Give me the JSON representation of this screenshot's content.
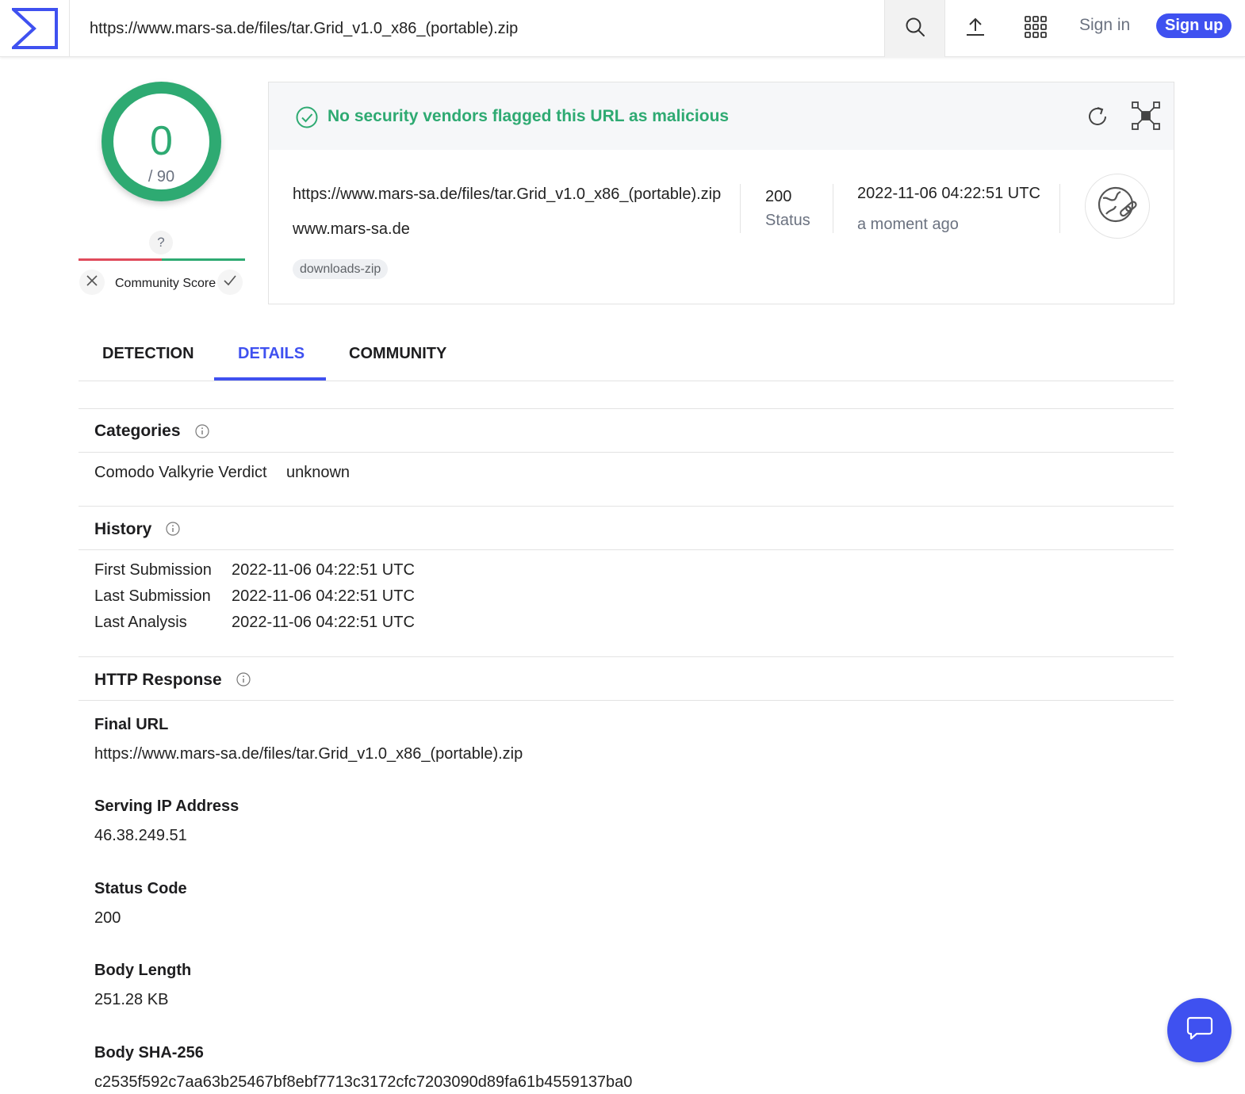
{
  "topbar": {
    "url_value": "https://www.mars-sa.de/files/tar.Grid_v1.0_x86_(portable).zip",
    "sign_in": "Sign in",
    "sign_up": "Sign up"
  },
  "score": {
    "detections": "0",
    "total": "/ 90",
    "community_question": "?",
    "community_label": "Community Score"
  },
  "summary": {
    "verdict": "No security vendors flagged this URL as malicious",
    "url": "https://www.mars-sa.de/files/tar.Grid_v1.0_x86_(portable).zip",
    "domain": "www.mars-sa.de",
    "tag": "downloads-zip",
    "status_code": "200",
    "status_label": "Status",
    "date": "2022-11-06 04:22:51 UTC",
    "date_relative": "a moment ago"
  },
  "tabs": [
    {
      "label": "DETECTION",
      "active": false
    },
    {
      "label": "DETAILS",
      "active": true
    },
    {
      "label": "COMMUNITY",
      "active": false
    }
  ],
  "categories": {
    "title": "Categories",
    "rows": [
      {
        "key": "Comodo Valkyrie Verdict",
        "value": "unknown"
      }
    ]
  },
  "history": {
    "title": "History",
    "rows": [
      {
        "key": "First Submission",
        "value": "2022-11-06 04:22:51 UTC"
      },
      {
        "key": "Last Submission",
        "value": "2022-11-06 04:22:51 UTC"
      },
      {
        "key": "Last Analysis",
        "value": "2022-11-06 04:22:51 UTC"
      }
    ]
  },
  "http_response": {
    "title": "HTTP Response",
    "fields": [
      {
        "label": "Final URL",
        "value": "https://www.mars-sa.de/files/tar.Grid_v1.0_x86_(portable).zip"
      },
      {
        "label": "Serving IP Address",
        "value": "46.38.249.51"
      },
      {
        "label": "Status Code",
        "value": "200"
      },
      {
        "label": "Body Length",
        "value": "251.28 KB"
      },
      {
        "label": "Body SHA-256",
        "value": "c2535f592c7aa63b25467bf8ebf7713c3172cfc7203090d89fa61b4559137ba0"
      }
    ]
  },
  "colors": {
    "accent": "#3f51f0",
    "clean_green": "#2eaa72",
    "malicious_red": "#e04b5b"
  },
  "icons": [
    "virustotal-logo-icon",
    "search-icon",
    "upload-icon",
    "apps-grid-icon",
    "check-circle-icon",
    "reanalyze-icon",
    "graph-icon",
    "url-link-icon",
    "info-icon",
    "close-icon",
    "check-icon",
    "chat-icon"
  ]
}
